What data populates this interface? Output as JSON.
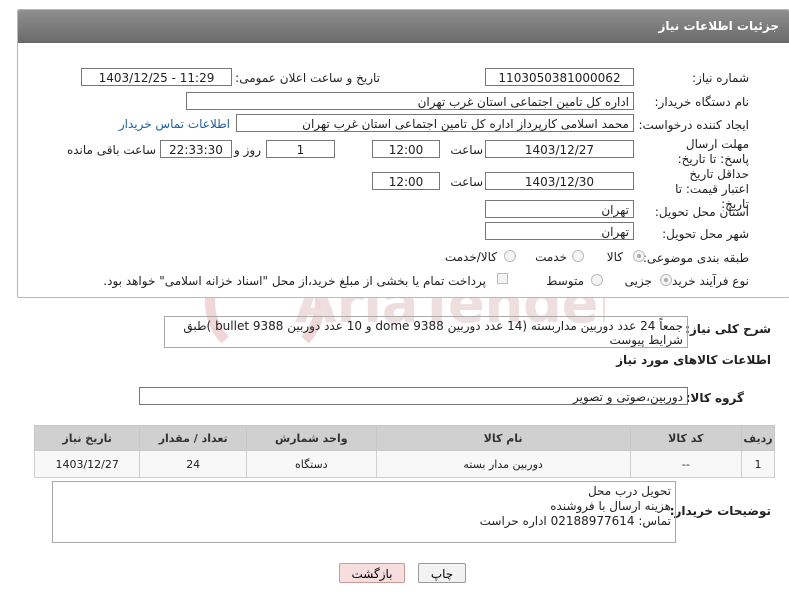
{
  "header": {
    "title": "جزئیات اطلاعات نیاز"
  },
  "form": {
    "need_number_label": "شماره نیاز:",
    "need_number": "1103050381000062",
    "announce_label": "تاریخ و ساعت اعلان عمومی:",
    "announce_value": "1403/12/25 - 11:29",
    "buyer_org_label": "نام دستگاه خریدار:",
    "buyer_org": "اداره کل تامین اجتماعی استان غرب تهران",
    "creator_label": "ایجاد کننده درخواست:",
    "creator": "محمد اسلامی کارپرداز اداره کل تامین اجتماعی استان غرب تهران",
    "contact_link": "اطلاعات تماس خریدار",
    "deadline_label": "مهلت ارسال پاسخ: تا تاریخ:",
    "deadline_date": "1403/12/27",
    "time_label": "ساعت",
    "deadline_time": "12:00",
    "days_value": "1",
    "days_label": "روز و",
    "remaining_time": "22:33:30",
    "remaining_label": "ساعت باقی مانده",
    "validity_label": "حداقل تاریخ اعتبار قیمت: تا تاریخ:",
    "validity_date": "1403/12/30",
    "validity_time": "12:00",
    "province_label": "استان محل تحویل:",
    "province": "تهران",
    "city_label": "شهر محل تحویل:",
    "city": "تهران",
    "category_label": "طبقه بندی موضوعی:",
    "category_options": [
      "کالا",
      "خدمت",
      "کالا/خدمت"
    ],
    "process_label": "نوع فرآیند خرید :",
    "process_options": [
      "جزیی",
      "متوسط"
    ],
    "payment_note": "پرداخت تمام یا بخشی از مبلغ خرید،از محل \"اسناد خزانه اسلامی\" خواهد بود."
  },
  "description": {
    "label": "شرح کلی نیاز:",
    "text": "جمعاً 24 عدد دوربین مداربسته (14 عدد دوربین dome 9388 و 10 عدد دوربین bullet 9388 )طبق شرایط پیوست"
  },
  "goods": {
    "section_title": "اطلاعات کالاهای مورد نیاز",
    "group_label": "گروه کالا:",
    "group_value": "دوربین،صوتی و تصویر",
    "columns": [
      "ردیف",
      "کد کالا",
      "نام کالا",
      "واحد شمارش",
      "تعداد / مقدار",
      "تاریخ نیاز"
    ],
    "rows": [
      [
        "1",
        "--",
        "دوربین مدار بسته",
        "دستگاه",
        "24",
        "1403/12/27"
      ]
    ]
  },
  "buyer_notes": {
    "label": "توضیحات خریدار:",
    "lines": [
      "تحویل درب محل",
      "هزینه ارسال با فروشنده",
      "تماس: 02188977614 اداره حراست"
    ]
  },
  "buttons": {
    "print": "چاپ",
    "back": "بازگشت"
  },
  "watermark_text": "AriaTender.neT"
}
